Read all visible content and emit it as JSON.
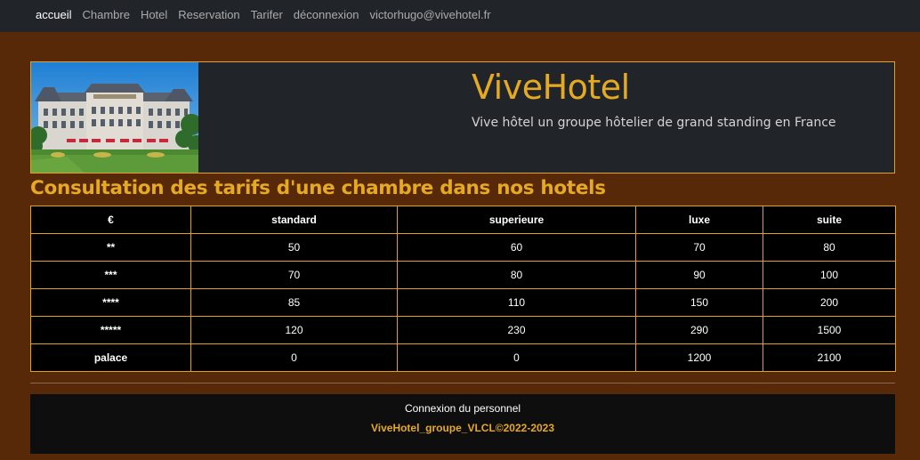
{
  "nav": {
    "items": [
      {
        "label": "accueil",
        "active": true
      },
      {
        "label": "Chambre"
      },
      {
        "label": "Hotel"
      },
      {
        "label": "Reservation"
      },
      {
        "label": "Tarifer"
      },
      {
        "label": "déconnexion"
      },
      {
        "label": "victorhugo@vivehotel.fr"
      }
    ]
  },
  "header": {
    "title": "ViveHotel",
    "subtitle": "Vive hôtel un groupe hôtelier de grand standing en France"
  },
  "section": {
    "title": "Consultation des tarifs d'une chambre dans nos hotels"
  },
  "table": {
    "headers": [
      "€",
      "standard",
      "superieure",
      "luxe",
      "suite"
    ],
    "rows": [
      [
        "**",
        "50",
        "60",
        "70",
        "80"
      ],
      [
        "***",
        "70",
        "80",
        "90",
        "100"
      ],
      [
        "****",
        "85",
        "110",
        "150",
        "200"
      ],
      [
        "*****",
        "120",
        "230",
        "290",
        "1500"
      ],
      [
        "palace",
        "0",
        "0",
        "1200",
        "2100"
      ]
    ]
  },
  "footer": {
    "link": "Connexion du personnel",
    "copyright": "ViveHotel_groupe_VLCL©2022-2023"
  },
  "colors": {
    "background": "#582908",
    "navbar": "#212529",
    "accent": "#e6a922",
    "table_bg": "#000000"
  }
}
